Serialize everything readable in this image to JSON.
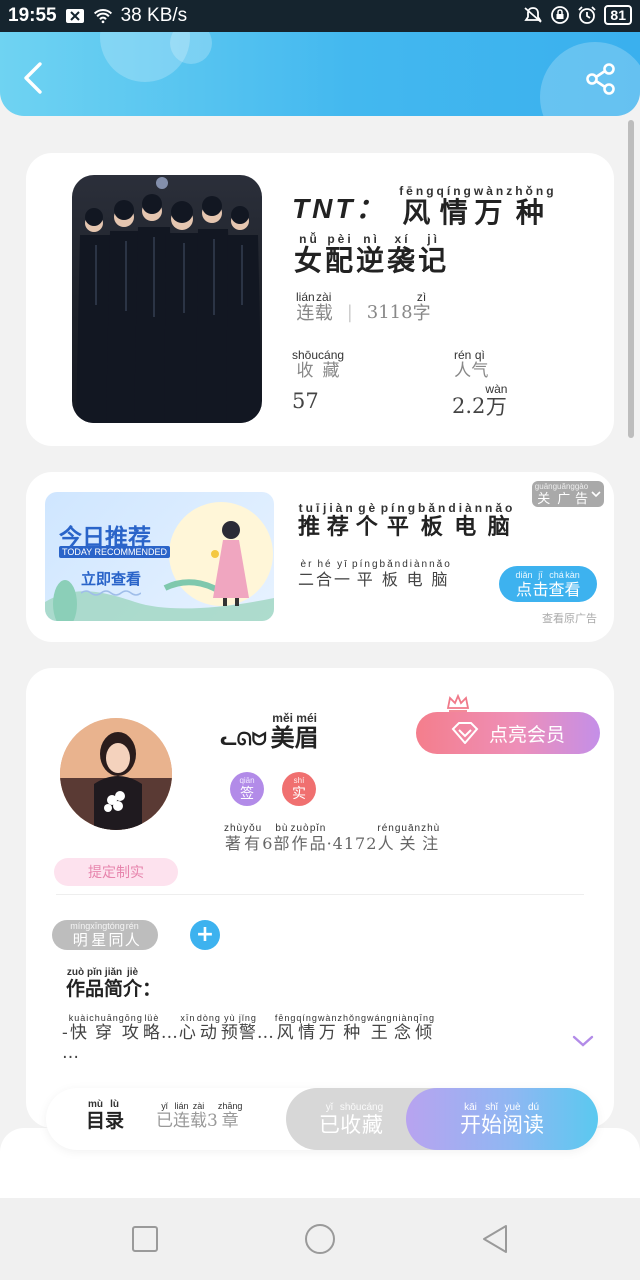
{
  "status_bar": {
    "time": "19:55",
    "network_speed": "38 KB/s",
    "battery": "81",
    "icons": [
      "notification-x-icon",
      "wifi-icon",
      "mute-icon",
      "lock-icon",
      "alarm-icon",
      "battery-icon"
    ]
  },
  "header": {
    "back_icon": "back-chevron-icon",
    "share_icon": "share-icon",
    "color": "#43b8ef"
  },
  "book": {
    "title_prefix": "TNT：",
    "title_line1": [
      {
        "hz": "风",
        "py": "fēng"
      },
      {
        "hz": "情",
        "py": "qíng"
      },
      {
        "hz": "万",
        "py": "wàn"
      },
      {
        "hz": "种",
        "py": "zhǒng"
      }
    ],
    "title_line2": [
      {
        "hz": "女",
        "py": "nǚ"
      },
      {
        "hz": "配",
        "py": "pèi"
      },
      {
        "hz": "逆",
        "py": "nì"
      },
      {
        "hz": "袭",
        "py": "xí"
      },
      {
        "hz": "记",
        "py": "jì"
      }
    ],
    "status": [
      {
        "hz": "连",
        "py": "lián"
      },
      {
        "hz": "载",
        "py": "zài"
      }
    ],
    "word_count_num": "3118",
    "word_count_unit": {
      "hz": "字",
      "py": "zì"
    },
    "collect_label": [
      {
        "hz": "收",
        "py": "shōu"
      },
      {
        "hz": "藏",
        "py": "cáng"
      }
    ],
    "collect_value": "57",
    "popularity_label": [
      {
        "hz": "人",
        "py": "rén"
      },
      {
        "hz": "气",
        "py": "qì"
      }
    ],
    "popularity_num": "2.2",
    "popularity_unit": {
      "hz": "万",
      "py": "wàn"
    }
  },
  "ad": {
    "banner_title": "今日推荐",
    "banner_subtitle": "TODAY RECOMMENDED",
    "banner_cta": "立即查看",
    "close_label": [
      {
        "hz": "关",
        "py": "guān"
      },
      {
        "hz": "广",
        "py": "guǎng"
      },
      {
        "hz": "告",
        "py": "gào"
      }
    ],
    "title": [
      {
        "hz": "推",
        "py": "tuī"
      },
      {
        "hz": "荐",
        "py": "jiàn"
      },
      {
        "hz": "个",
        "py": "gè"
      },
      {
        "hz": "平",
        "py": "píng"
      },
      {
        "hz": "板",
        "py": "bǎn"
      },
      {
        "hz": "电",
        "py": "diàn"
      },
      {
        "hz": "脑",
        "py": "nǎo"
      }
    ],
    "subtitle": [
      {
        "hz": "二",
        "py": "èr"
      },
      {
        "hz": "合",
        "py": "hé"
      },
      {
        "hz": "一",
        "py": "yī"
      },
      {
        "hz": "平",
        "py": "píng"
      },
      {
        "hz": "板",
        "py": "bǎn"
      },
      {
        "hz": "电",
        "py": "diàn"
      },
      {
        "hz": "脑",
        "py": "nǎo"
      }
    ],
    "click_btn": [
      {
        "hz": "点",
        "py": "diǎn"
      },
      {
        "hz": "击",
        "py": "jī"
      },
      {
        "hz": "查",
        "py": "chá"
      },
      {
        "hz": "看",
        "py": "kàn"
      }
    ],
    "note": "查看原广告"
  },
  "author": {
    "name_prefix": "ᓚᘏᗢ",
    "name": [
      {
        "hz": "美",
        "py": "měi"
      },
      {
        "hz": "眉",
        "py": "méi"
      }
    ],
    "vip_button": "点亮会员",
    "badge_sign": {
      "hz": "签",
      "py": "qiān"
    },
    "badge_real": {
      "hz": "实",
      "py": "shí"
    },
    "info": [
      {
        "hz": "著",
        "py": "zhù"
      },
      {
        "hz": "有",
        "py": "yǒu"
      },
      {
        "hz": "6",
        "py": ""
      },
      {
        "hz": "部",
        "py": "bù"
      },
      {
        "hz": "作",
        "py": "zuò"
      },
      {
        "hz": "品",
        "py": "pǐn"
      },
      {
        "hz": "·4172",
        "py": ""
      },
      {
        "hz": "人",
        "py": "rén"
      },
      {
        "hz": "关",
        "py": "guān"
      },
      {
        "hz": "注",
        "py": "zhù"
      }
    ],
    "edit_label": "提定制实",
    "tag": [
      {
        "hz": "明",
        "py": "míng"
      },
      {
        "hz": "星",
        "py": "xīng"
      },
      {
        "hz": "同",
        "py": "tóng"
      },
      {
        "hz": "人",
        "py": "rén"
      }
    ],
    "add_tag": "+",
    "intro_label": [
      {
        "hz": "作",
        "py": "zuò"
      },
      {
        "hz": "品",
        "py": "pǐn"
      },
      {
        "hz": "简",
        "py": "jiǎn"
      },
      {
        "hz": "介",
        "py": "jiè"
      },
      {
        "hz": "：",
        "py": ""
      }
    ],
    "intro_text": [
      {
        "hz": "-",
        "py": ""
      },
      {
        "hz": "快",
        "py": "kuài"
      },
      {
        "hz": "穿",
        "py": "chuān"
      },
      {
        "hz": "攻",
        "py": "gōng"
      },
      {
        "hz": "略",
        "py": "lüè"
      },
      {
        "hz": "…",
        "py": ""
      },
      {
        "hz": "心",
        "py": "xīn"
      },
      {
        "hz": "动",
        "py": "dòng"
      },
      {
        "hz": "预",
        "py": "yù"
      },
      {
        "hz": "警",
        "py": "jǐng"
      },
      {
        "hz": "…",
        "py": ""
      },
      {
        "hz": "风",
        "py": "fēng"
      },
      {
        "hz": "情",
        "py": "qíng"
      },
      {
        "hz": "万",
        "py": "wàn"
      },
      {
        "hz": "种",
        "py": "zhǒng"
      },
      {
        "hz": "王",
        "py": "wáng"
      },
      {
        "hz": "念",
        "py": "niàn"
      },
      {
        "hz": "倾",
        "py": "qīng"
      }
    ],
    "intro_more": "…"
  },
  "bottom_bar": {
    "catalog": [
      {
        "hz": "目",
        "py": "mù"
      },
      {
        "hz": "录",
        "py": "lù"
      }
    ],
    "serial": [
      {
        "hz": "已",
        "py": "yǐ"
      },
      {
        "hz": "连",
        "py": "lián"
      },
      {
        "hz": "载",
        "py": "zài"
      },
      {
        "hz": "3",
        "py": ""
      },
      {
        "hz": "章",
        "py": "zhāng"
      }
    ],
    "collected": [
      {
        "hz": "已",
        "py": "yǐ"
      },
      {
        "hz": "收",
        "py": "shōu"
      },
      {
        "hz": "藏",
        "py": "cáng"
      }
    ],
    "start_read": [
      {
        "hz": "开",
        "py": "kāi"
      },
      {
        "hz": "始",
        "py": "shǐ"
      },
      {
        "hz": "阅",
        "py": "yuè"
      },
      {
        "hz": "读",
        "py": "dú"
      }
    ]
  },
  "navbar": {
    "icons": [
      "recent-apps-icon",
      "home-icon",
      "back-icon"
    ]
  }
}
